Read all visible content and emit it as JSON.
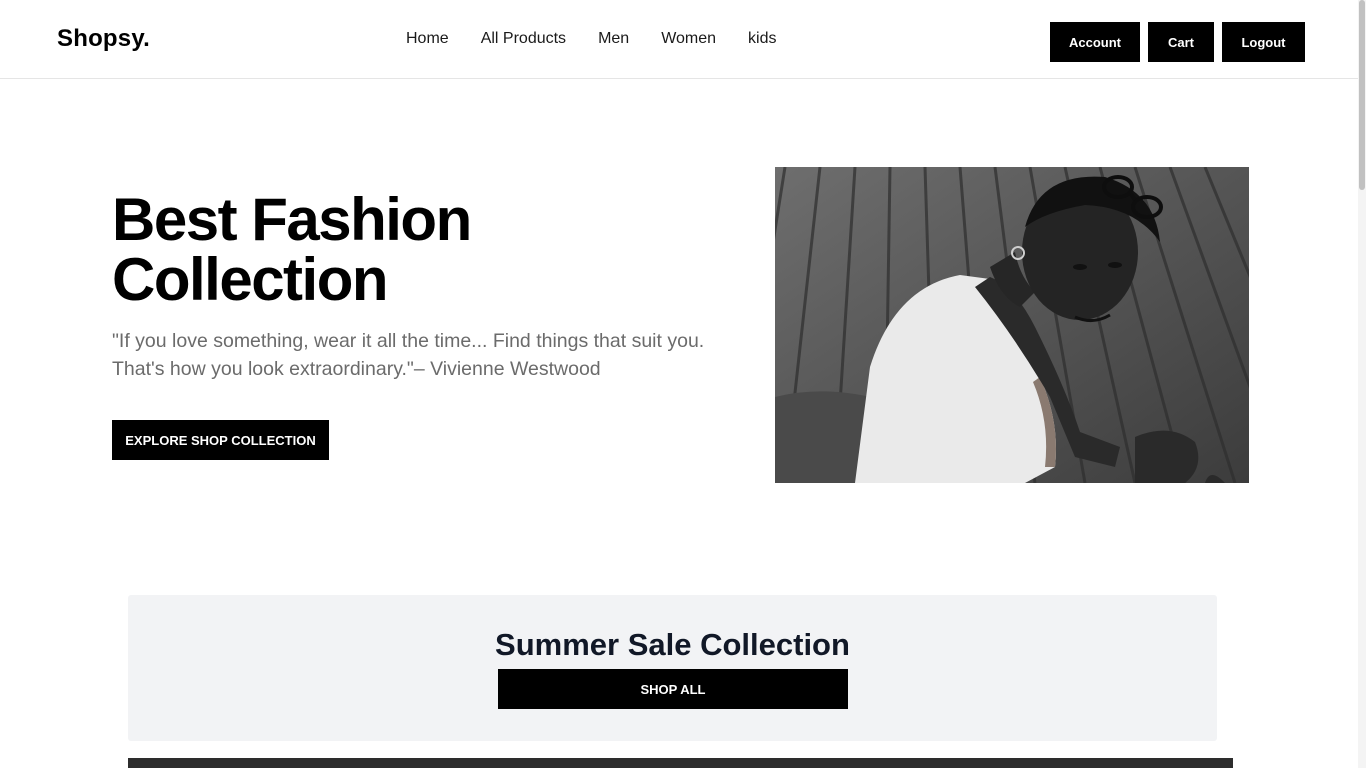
{
  "brand": {
    "logo": "Shopsy."
  },
  "nav": {
    "items": [
      {
        "label": "Home"
      },
      {
        "label": "All Products"
      },
      {
        "label": "Men"
      },
      {
        "label": "Women"
      },
      {
        "label": "kids"
      }
    ]
  },
  "header_actions": {
    "account": "Account",
    "cart": "Cart",
    "logout": "Logout"
  },
  "hero": {
    "title_line1": "Best Fashion",
    "title_line2": "Collection",
    "quote_line1": "\"If you love something, wear it all the time... Find things that suit you.",
    "quote_line2": "That's how you look extraordinary.\"– Vivienne Westwood",
    "cta": "EXPLORE SHOP COLLECTION",
    "image_alt": "woman-portrait-photo"
  },
  "sale": {
    "title": "Summer Sale Collection",
    "cta": "SHOP ALL"
  },
  "colors": {
    "primary": "#000000",
    "accent_indicator": "#1f6fd1",
    "banner_bg": "#f2f3f5",
    "quote_text": "#6b6b6b"
  }
}
